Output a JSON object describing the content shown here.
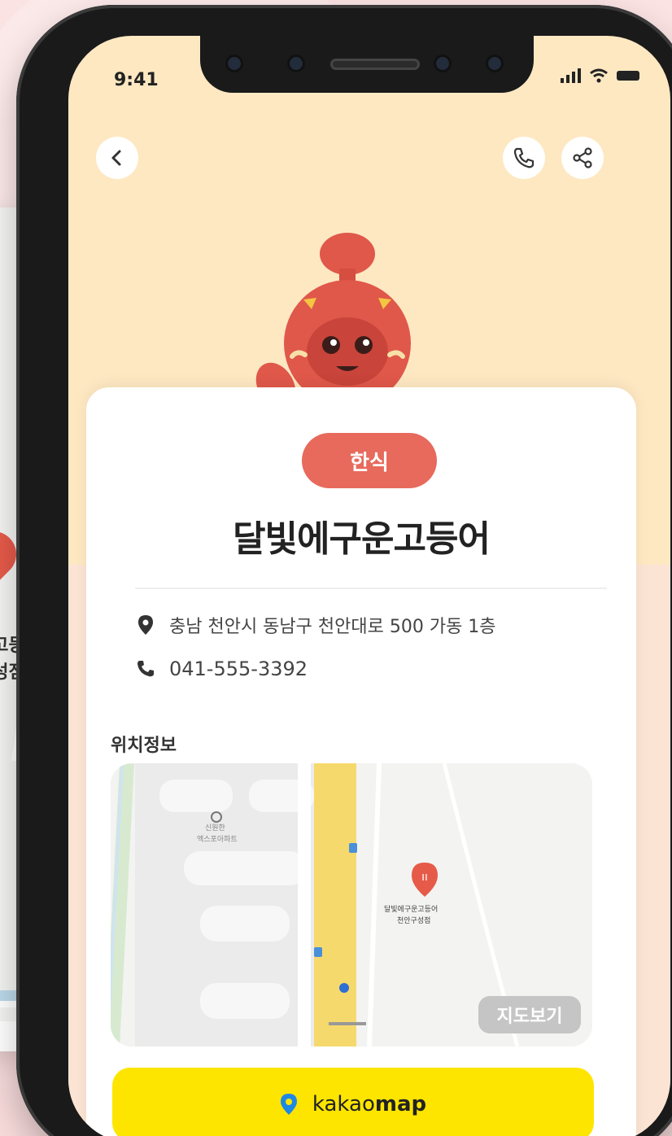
{
  "status_bar": {
    "time": "9:41"
  },
  "back_card": {
    "label_line1": "운고등어",
    "label_line2": "구성점"
  },
  "detail": {
    "category": "한식",
    "name": "달빛에구운고등어",
    "address": "충남 천안시 동남구 천안대로 500 가동 1층",
    "phone": "041-555-3392",
    "section_title": "위치정보",
    "map": {
      "poi_label_1": "달빛에구운고등어",
      "poi_label_2": "천안구성점",
      "apt_label_1": "신원한",
      "apt_label_2": "엑스포아파트",
      "view_map_label": "지도보기"
    },
    "kakao_button": {
      "prefix": "kakao",
      "suffix": "map"
    }
  },
  "colors": {
    "accent": "#e76a5c",
    "kakao": "#fee500",
    "screen_bg": "#fde8c2"
  },
  "icons": {
    "back": "chevron-left-icon",
    "call": "phone-icon",
    "share": "share-icon",
    "location": "map-pin-icon",
    "tel": "phone-icon"
  }
}
